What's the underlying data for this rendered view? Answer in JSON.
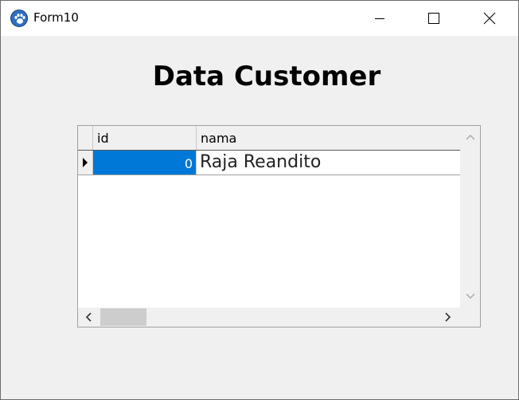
{
  "window": {
    "title": "Form10",
    "icon": "paw-icon"
  },
  "titlebar_buttons": [
    "minimize-icon",
    "maximize-icon",
    "close-icon"
  ],
  "heading": "Data Customer",
  "grid": {
    "columns": [
      "id",
      "nama"
    ],
    "rows": [
      {
        "id": "0",
        "nama": "Raja Reandito",
        "selected_cell": "id",
        "current_row_marker": "row-pointer-icon"
      }
    ],
    "selection_color": "#0078d7"
  }
}
